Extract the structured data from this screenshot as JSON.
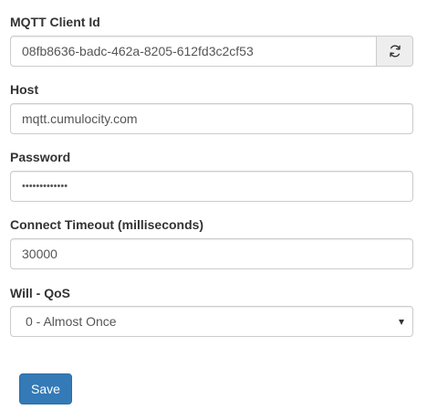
{
  "form": {
    "client_id": {
      "label": "MQTT Client Id",
      "value": "08fb8636-badc-462a-8205-612fd3c2cf53",
      "refresh_icon": "refresh-icon"
    },
    "host": {
      "label": "Host",
      "value": "mqtt.cumulocity.com"
    },
    "password": {
      "label": "Password",
      "value_masked": "•••••••••••••"
    },
    "connect_timeout": {
      "label": "Connect Timeout (milliseconds)",
      "value": "30000"
    },
    "will_qos": {
      "label": "Will - QoS",
      "selected": "0 - Almost Once",
      "arrow_icon": "caret-down-icon"
    },
    "save_label": "Save"
  },
  "colors": {
    "primary_button": "#337ab7",
    "input_border": "#cccccc",
    "addon_background": "#eeeeee",
    "label_text": "#333333",
    "input_text": "#555555"
  }
}
